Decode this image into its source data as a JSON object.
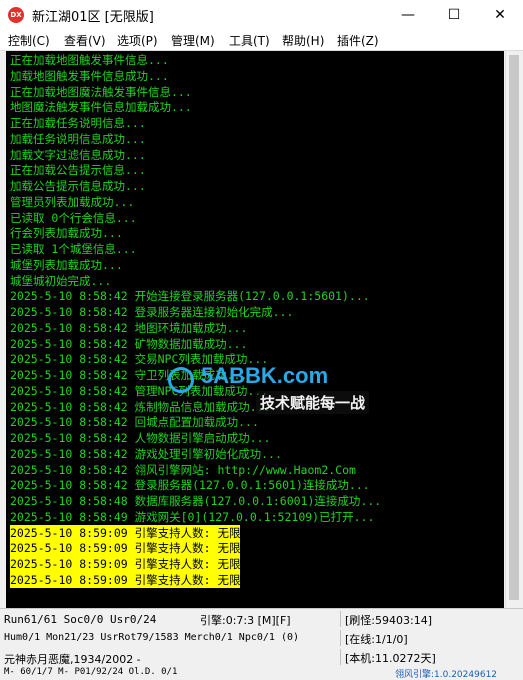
{
  "window": {
    "icon_text": "DX",
    "title": "新江湖01区 [无限版]",
    "minimize": "—",
    "maximize": "☐",
    "close": "✕"
  },
  "menu": [
    "控制(C)",
    "查看(V)",
    "选项(P)",
    "管理(M)",
    "工具(T)",
    "帮助(H)",
    "插件(Z)"
  ],
  "console_lines": [
    "正在加载地图触发事件信息...",
    "加载地图触发事件信息成功...",
    "正在加载地图魔法触发事件信息...",
    "地图魔法触发事件信息加载成功...",
    "正在加载任务说明信息...",
    "加载任务说明信息成功...",
    "加载文字过滤信息成功...",
    "正在加载公告提示信息...",
    "加载公告提示信息成功...",
    "管理员列表加载成功...",
    "已读取 0个行会信息...",
    "行会列表加载成功...",
    "已读取 1个城堡信息...",
    "城堡列表加载成功...",
    "城堡城初始完成...",
    "2025-5-10 8:58:42 开始连接登录服务器(127.0.0.1:5601)...",
    "2025-5-10 8:58:42 登录服务器连接初始化完成...",
    "2025-5-10 8:58:42 地图环境加载成功...",
    "2025-5-10 8:58:42 矿物数据加载成功...",
    "2025-5-10 8:58:42 交易NPC列表加载成功...",
    "2025-5-10 8:58:42 守卫列表加载成功...",
    "2025-5-10 8:58:42 管理NPC列表加载成功...",
    "2025-5-10 8:58:42 炼制物品信息加载成功...",
    "2025-5-10 8:58:42 回城点配置加载成功...",
    "2025-5-10 8:58:42 人物数据引擎启动成功...",
    "2025-5-10 8:58:42 游戏处理引擎初始化成功...",
    "2025-5-10 8:58:42 翎风引擎网站: http://www.Haom2.Com",
    "2025-5-10 8:58:42 登录服务器(127.0.0.1:5601)连接成功...",
    "2025-5-10 8:58:48 数据库服务器(127.0.0.1:6001)连接成功...",
    "2025-5-10 8:58:49 游戏网关[0](127.0.0.1:52109)已打开..."
  ],
  "highlight_lines": [
    "2025-5-10 8:59:09 引擎支持人数: 无限",
    "2025-5-10 8:59:09 引擎支持人数: 无限",
    "2025-5-10 8:59:09 引擎支持人数: 无限",
    "2025-5-10 8:59:09 引擎支持人数: 无限"
  ],
  "watermark": {
    "site": "5ABBK.com",
    "slogan": "技术赋能每一战"
  },
  "status": {
    "row1_left": "Run61/61 Soc0/0 Usr0/24",
    "row1_mid": "引擎:0:7:3 [M][F]",
    "row1_right": "[刷怪:59403:14]",
    "row2_left": "Hum0/1 Mon21/23 UsrRot79/1583 Merch0/1 Npc0/1 (0)",
    "row2_right": "[在线:1/1/0]",
    "row3_left": "元神赤月恶魔,1934/2002 -",
    "row3_right": "[本机:11.0272天]",
    "row4_left": "M- 60/1/7 M- P01/92/24 Ol.D. 0/1",
    "row4_right": "翎风引擎:1.0.20249612"
  },
  "colors": {
    "console_bg": "#000000",
    "console_text": "#21d321",
    "highlight_bg": "#ffff00",
    "highlight_text": "#000000"
  }
}
